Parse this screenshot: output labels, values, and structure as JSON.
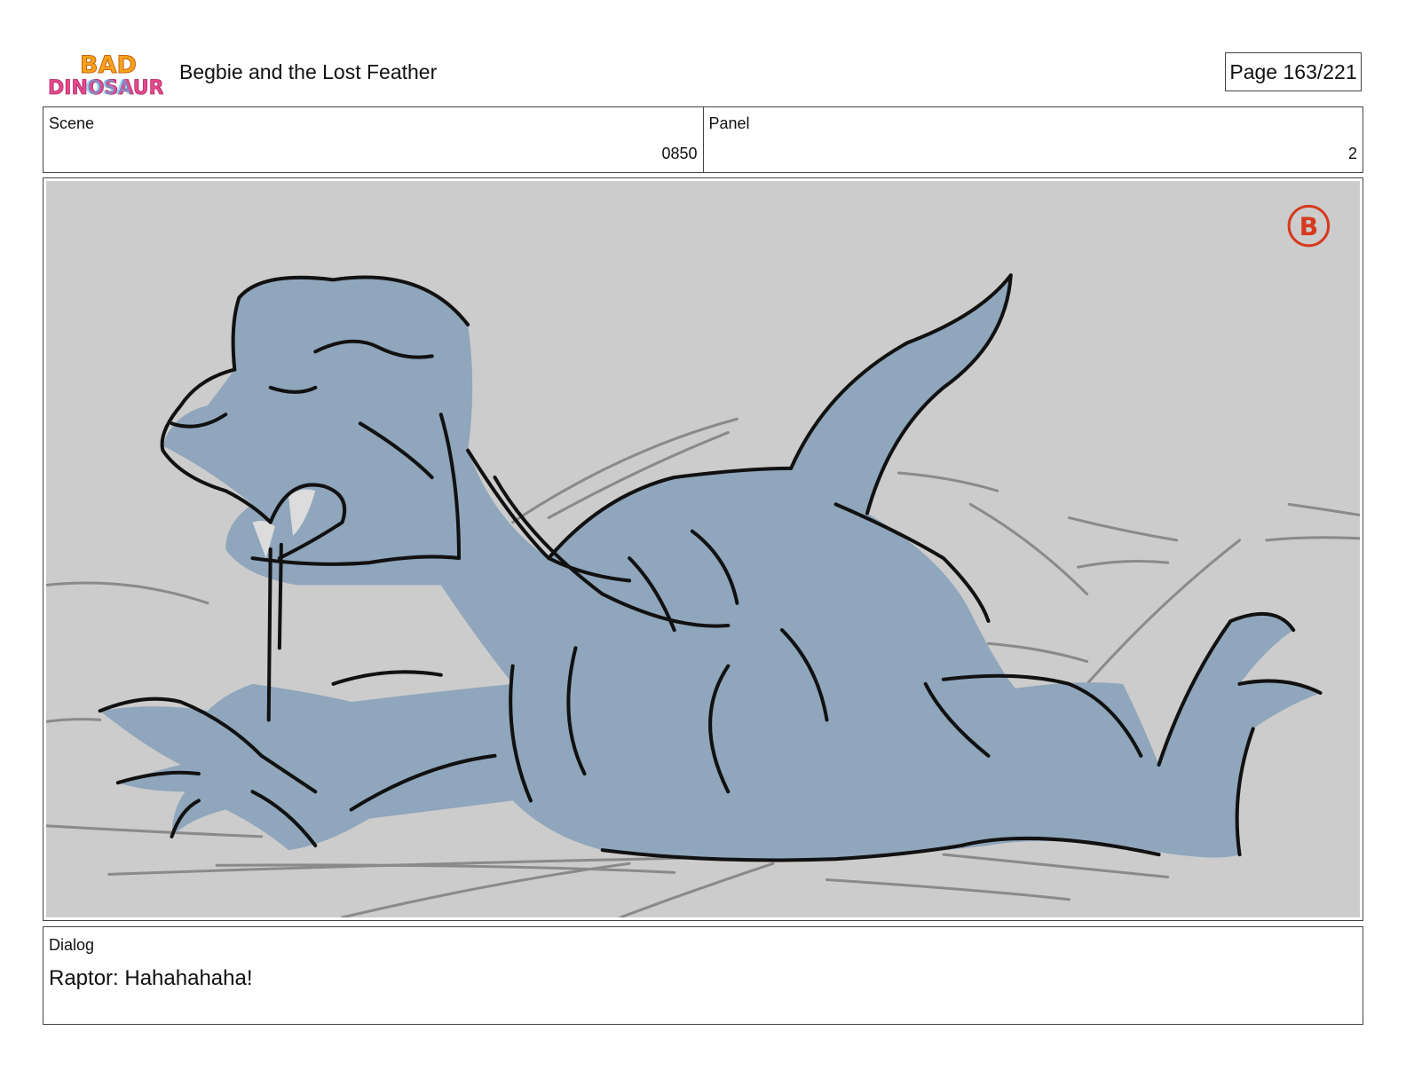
{
  "header": {
    "logo_text": "BAD DINOSAURS",
    "title": "Begbie and the Lost Feather",
    "page_label": "Page 163/221"
  },
  "info": {
    "scene_label": "Scene",
    "scene_value": "0850",
    "panel_label": "Panel",
    "panel_value": "2"
  },
  "panel_image": {
    "description_icon": "raptor-sketch",
    "background_color": "#cccccc",
    "body_color": "#8fa6bc",
    "stamp_letter": "B",
    "stamp_color": "#d63a1e"
  },
  "dialog": {
    "label": "Dialog",
    "text": "Raptor: Hahahahaha!"
  }
}
